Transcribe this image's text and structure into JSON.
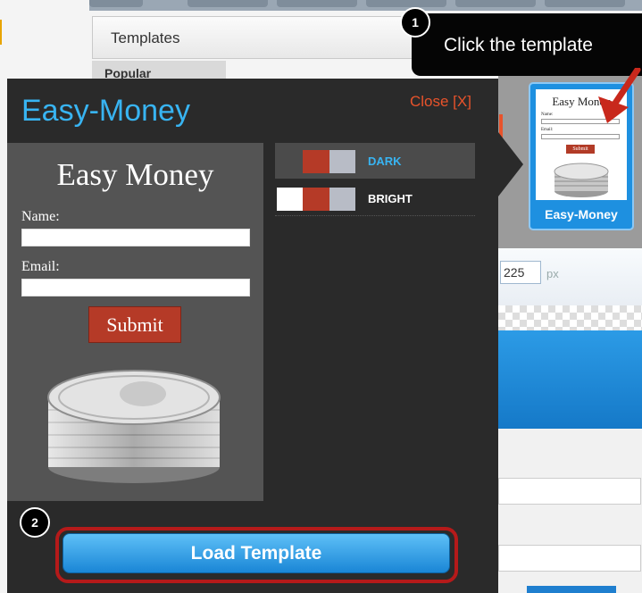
{
  "background": {
    "templates_header": "Templates",
    "popular_tab": "Popular",
    "width_value": "225",
    "width_unit": "px"
  },
  "thumbnail": {
    "preview_title": "Easy Money",
    "name_label": "Name:",
    "email_label": "Email:",
    "submit_label": "Submit",
    "caption": "Easy-Money"
  },
  "popup": {
    "title": "Easy-Money",
    "close_label": "Close [X]",
    "preview": {
      "title": "Easy Money",
      "name_label": "Name:",
      "email_label": "Email:",
      "submit_label": "Submit",
      "image_icon": "coin-stack-icon"
    },
    "themes": [
      {
        "label": "DARK",
        "label_color": "#38b4f2",
        "swatch": [
          "#4b4b4b",
          "#b53a27",
          "#b8bcc6"
        ],
        "selected": true
      },
      {
        "label": "BRIGHT",
        "label_color": "#ffffff",
        "swatch": [
          "#ffffff",
          "#b53a27",
          "#b8bcc6"
        ],
        "selected": false
      }
    ],
    "load_button": "Load Template"
  },
  "callouts": {
    "step1_number": "1",
    "step1_text": "Click the template",
    "step2_number": "2"
  },
  "colors": {
    "accent_blue": "#38b4f2",
    "close_red": "#e8532b",
    "highlight_red": "#b51a1a"
  }
}
